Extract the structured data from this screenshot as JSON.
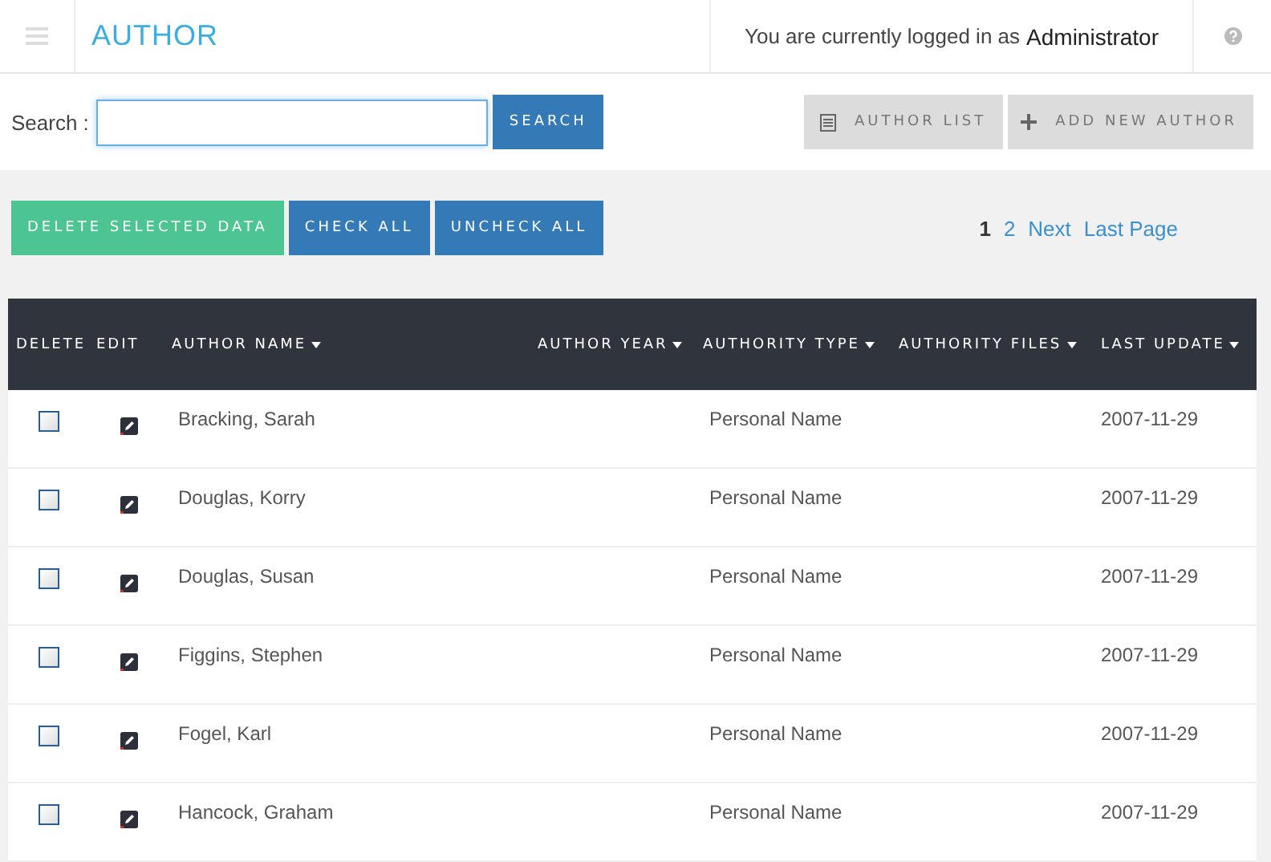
{
  "header": {
    "title": "AUTHOR",
    "login_text": "You are currently logged in as",
    "user": "Administrator"
  },
  "search": {
    "label": "Search :",
    "button": "SEARCH"
  },
  "nav_buttons": [
    {
      "label": "AUTHOR LIST",
      "kind": "list"
    },
    {
      "label": "ADD NEW AUTHOR",
      "kind": "add"
    }
  ],
  "actions": [
    {
      "label": "DELETE SELECTED DATA",
      "kind": "danger"
    },
    {
      "label": "CHECK ALL",
      "kind": "primary"
    },
    {
      "label": "UNCHECK ALL",
      "kind": "primary"
    }
  ],
  "pagination": [
    {
      "label": "1",
      "selected": true
    },
    {
      "label": "2",
      "selected": false
    },
    {
      "label": "Next",
      "selected": false
    },
    {
      "label": "Last Page",
      "selected": false
    }
  ],
  "table": {
    "columns": [
      {
        "label": "DELETE",
        "sortable": false
      },
      {
        "label": "EDIT",
        "sortable": false
      },
      {
        "label": "AUTHOR NAME",
        "sortable": true
      },
      {
        "label": "AUTHOR YEAR",
        "sortable": true
      },
      {
        "label": "AUTHORITY TYPE",
        "sortable": true
      },
      {
        "label": "AUTHORITY FILES",
        "sortable": true
      },
      {
        "label": "LAST UPDATE",
        "sortable": true
      }
    ],
    "rows": [
      {
        "checked": false,
        "name": "Bracking, Sarah",
        "type": "Personal Name",
        "updated": "2007-11-29"
      },
      {
        "checked": false,
        "name": "Douglas, Korry",
        "type": "Personal Name",
        "updated": "2007-11-29"
      },
      {
        "checked": false,
        "name": "Douglas, Susan",
        "type": "Personal Name",
        "updated": "2007-11-29"
      },
      {
        "checked": false,
        "name": "Figgins, Stephen",
        "type": "Personal Name",
        "updated": "2007-11-29"
      },
      {
        "checked": false,
        "name": "Fogel, Karl",
        "type": "Personal Name",
        "updated": "2007-11-29"
      },
      {
        "checked": false,
        "name": "Hancock, Graham",
        "type": "Personal Name",
        "updated": "2007-11-29"
      }
    ]
  }
}
